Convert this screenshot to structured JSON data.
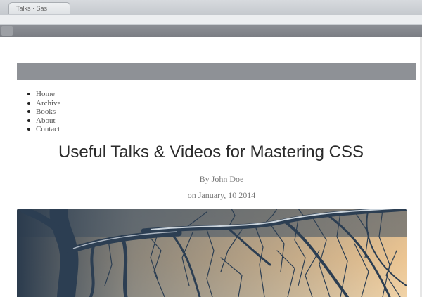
{
  "browser": {
    "tab_title": "Talks · Sas"
  },
  "nav": {
    "items": [
      "Home",
      "Archive",
      "Books",
      "About",
      "Contact"
    ]
  },
  "post": {
    "title": "Useful Talks & Videos for Mastering CSS",
    "byline": "By John Doe",
    "date": "on January, 10 2014"
  },
  "colors": {
    "header_bar": "#8e9196",
    "sky_light": "#e9c08e",
    "branches": "#2c3e52"
  }
}
